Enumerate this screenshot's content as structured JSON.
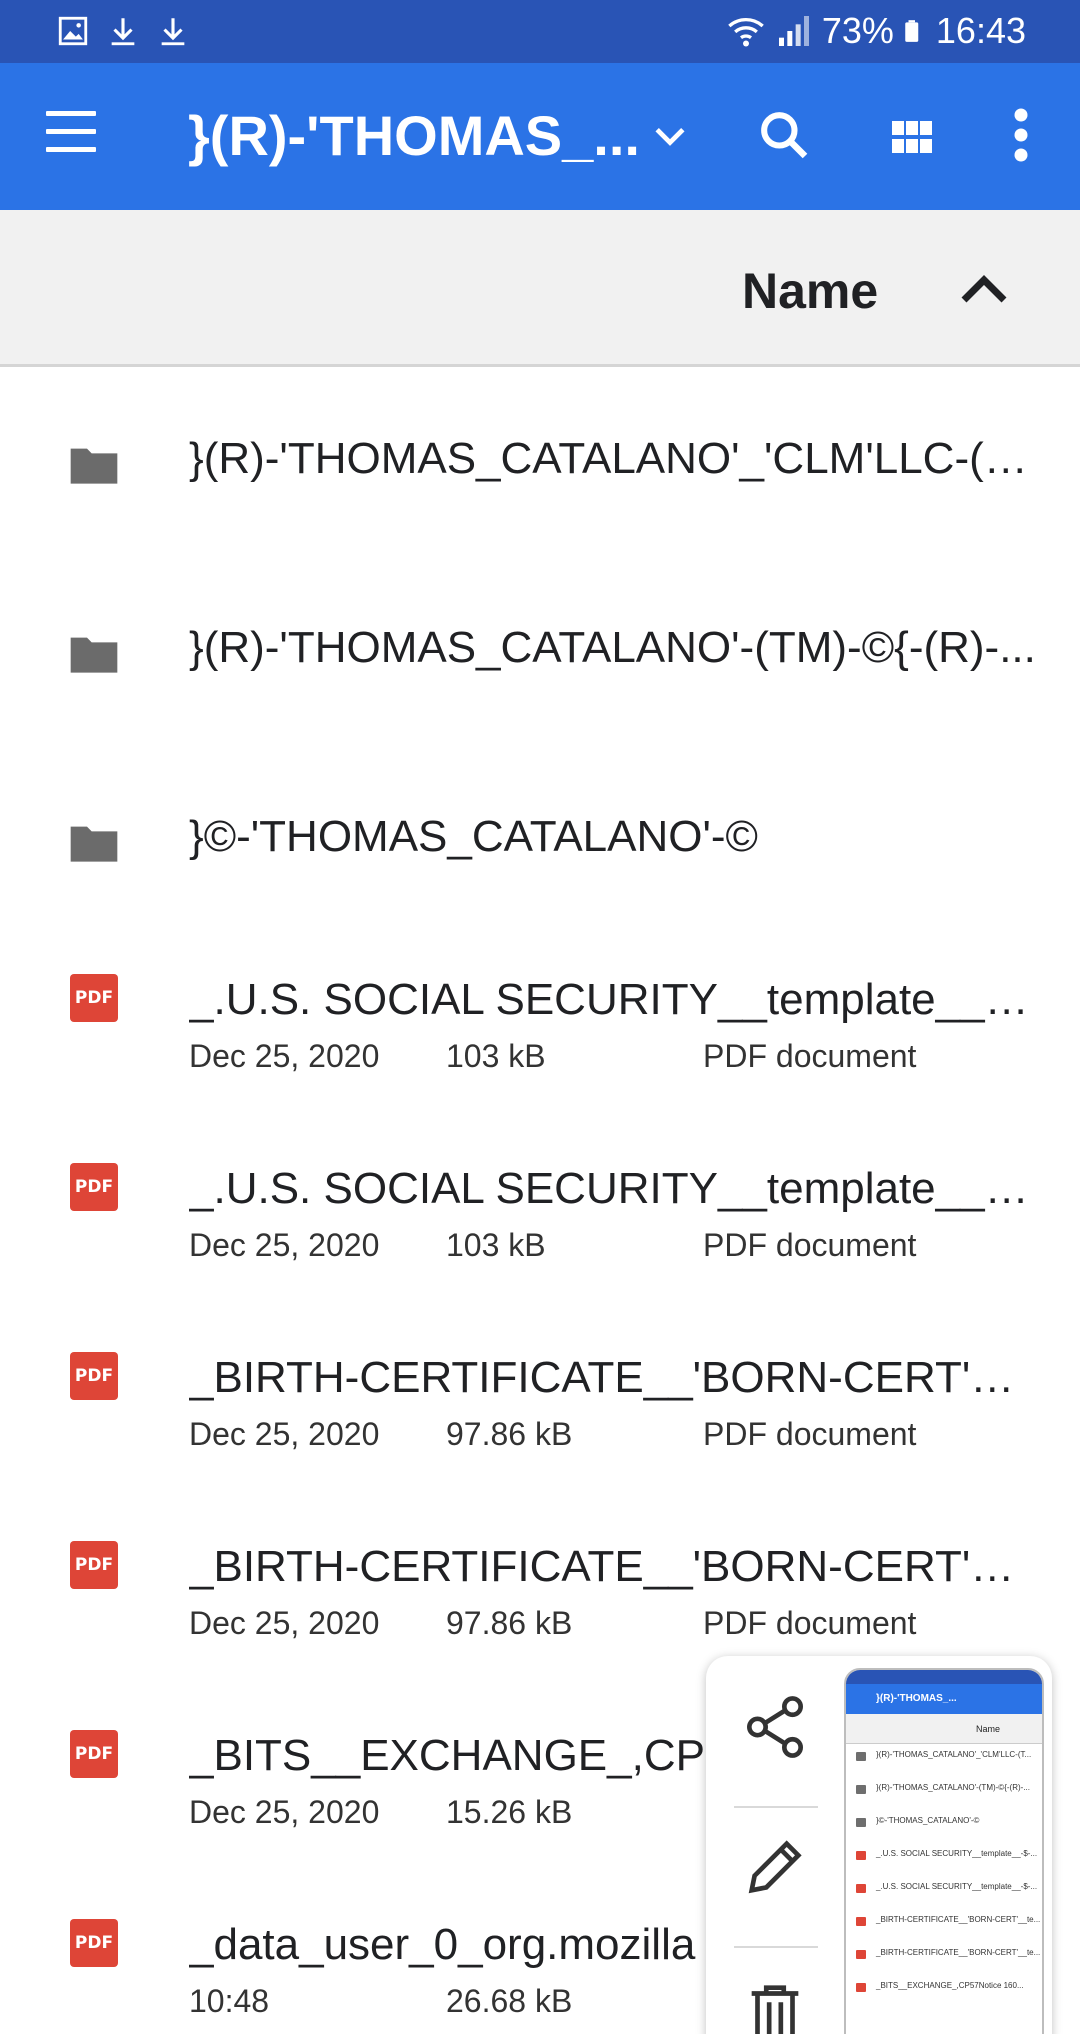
{
  "status_bar": {
    "battery": "73%",
    "time": "16:43",
    "left_icons": [
      "image-notification-icon",
      "download-icon",
      "download-icon"
    ],
    "right_icons": [
      "wifi-icon",
      "signal-icon",
      "battery-icon"
    ]
  },
  "app_bar": {
    "title": "}(R)-'THOMAS_...",
    "background": "#2b73e6"
  },
  "sort_bar": {
    "label": "Name",
    "direction": "ascending"
  },
  "files": [
    {
      "name": "}(R)-'THOMAS_CATALANO'_'CLM'LLC-(T...",
      "type": "folder"
    },
    {
      "name": "}(R)-'THOMAS_CATALANO'-(TM)-©{-(R)-...",
      "type": "folder"
    },
    {
      "name": "}©-'THOMAS_CATALANO'-©",
      "type": "folder"
    },
    {
      "name": "_.U.S. SOCIAL SECURITY__template__-$-...",
      "type": "pdf",
      "date": "Dec 25, 2020",
      "size": "103 kB",
      "kind": "PDF document"
    },
    {
      "name": "_.U.S. SOCIAL SECURITY__template__-$-...",
      "type": "pdf",
      "date": "Dec 25, 2020",
      "size": "103 kB",
      "kind": "PDF document"
    },
    {
      "name": "_BIRTH-CERTIFICATE__'BORN-CERT'__te...",
      "type": "pdf",
      "date": "Dec 25, 2020",
      "size": "97.86 kB",
      "kind": "PDF document"
    },
    {
      "name": "_BIRTH-CERTIFICATE__'BORN-CERT'__te...",
      "type": "pdf",
      "date": "Dec 25, 2020",
      "size": "97.86 kB",
      "kind": "PDF document"
    },
    {
      "name": "_BITS__EXCHANGE_,CP57",
      "type": "pdf",
      "date": "Dec 25, 2020",
      "size": "15.26 kB",
      "kind": ""
    },
    {
      "name": "_data_user_0_org.mozilla",
      "type": "pdf",
      "date": "10:48",
      "size": "26.68 kB",
      "kind": ""
    }
  ],
  "pdf_badge": "PDF",
  "screenshot_panel": {
    "actions": [
      "share-icon",
      "edit-icon",
      "delete-icon"
    ],
    "thumbnail": {
      "title": "}(R)-'THOMAS_...",
      "sort_label": "Name",
      "rows": [
        "}(R)-'THOMAS_CATALANO'_'CLM'LLC-(T...",
        "}(R)-'THOMAS_CATALANO'-(TM)-©{-(R)-...",
        "}©-'THOMAS_CATALANO'-©",
        "_.U.S. SOCIAL SECURITY__template__-$-...",
        "_.U.S. SOCIAL SECURITY__template__-$-...",
        "_BIRTH-CERTIFICATE__'BORN-CERT'__te...",
        "_BIRTH-CERTIFICATE__'BORN-CERT'__te...",
        "_BITS__EXCHANGE_,CP57Notice 160..."
      ]
    }
  }
}
